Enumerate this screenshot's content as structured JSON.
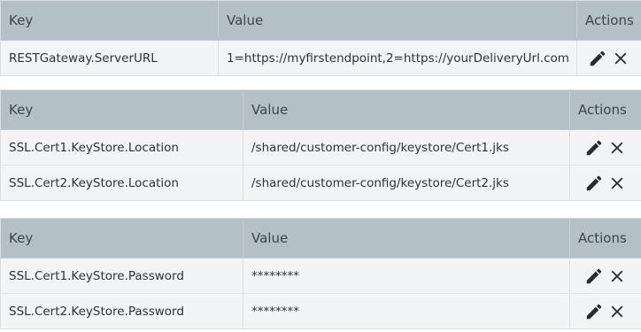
{
  "icons": {
    "edit": "pencil-icon",
    "delete": "close-icon"
  },
  "colors": {
    "header_bg": "#b4c0c8",
    "row_bg": "#f2f4f5",
    "icon": "#2b2b2b"
  },
  "tables": [
    {
      "headers": {
        "key": "Key",
        "value": "Value",
        "actions": "Actions"
      },
      "rows": [
        {
          "key": "RESTGateway.ServerURL",
          "value": "1=https://myfirstendpoint,2=https://yourDeliveryUrl.com"
        }
      ]
    },
    {
      "headers": {
        "key": "Key",
        "value": "Value",
        "actions": "Actions"
      },
      "rows": [
        {
          "key": "SSL.Cert1.KeyStore.Location",
          "value": "/shared/customer-config/keystore/Cert1.jks"
        },
        {
          "key": "SSL.Cert2.KeyStore.Location",
          "value": "/shared/customer-config/keystore/Cert2.jks"
        }
      ]
    },
    {
      "headers": {
        "key": "Key",
        "value": "Value",
        "actions": "Actions"
      },
      "rows": [
        {
          "key": "SSL.Cert1.KeyStore.Password",
          "value": "********"
        },
        {
          "key": "SSL.Cert2.KeyStore.Password",
          "value": "********"
        }
      ]
    }
  ]
}
